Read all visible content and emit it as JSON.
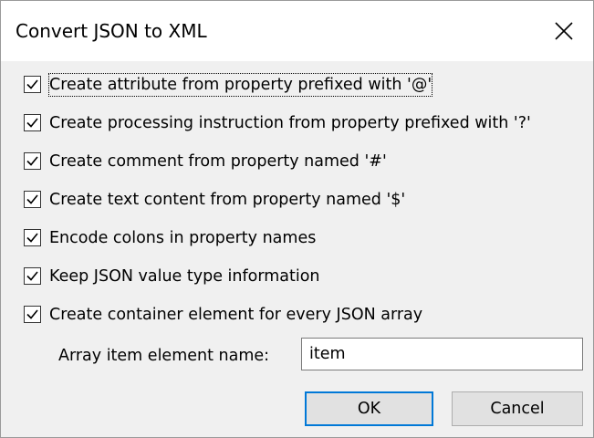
{
  "window": {
    "title": "Convert JSON to XML",
    "close_icon": "close-icon"
  },
  "options": [
    {
      "label": "Create attribute from property prefixed with '@'",
      "checked": true,
      "focused": true
    },
    {
      "label": "Create processing instruction from property prefixed with '?'",
      "checked": true
    },
    {
      "label": "Create comment from property named '#'",
      "checked": true
    },
    {
      "label": "Create text content from property named '$'",
      "checked": true
    },
    {
      "label": "Encode colons in property names",
      "checked": true
    },
    {
      "label": "Keep JSON value type information",
      "checked": true
    },
    {
      "label": "Create container element for every JSON array",
      "checked": true
    }
  ],
  "array_item": {
    "label": "Array item element name:",
    "value": "item"
  },
  "buttons": {
    "ok_label": "OK",
    "cancel_label": "Cancel"
  },
  "colors": {
    "default_button_border": "#0078d7",
    "dialog_background": "#f0f0f0"
  }
}
